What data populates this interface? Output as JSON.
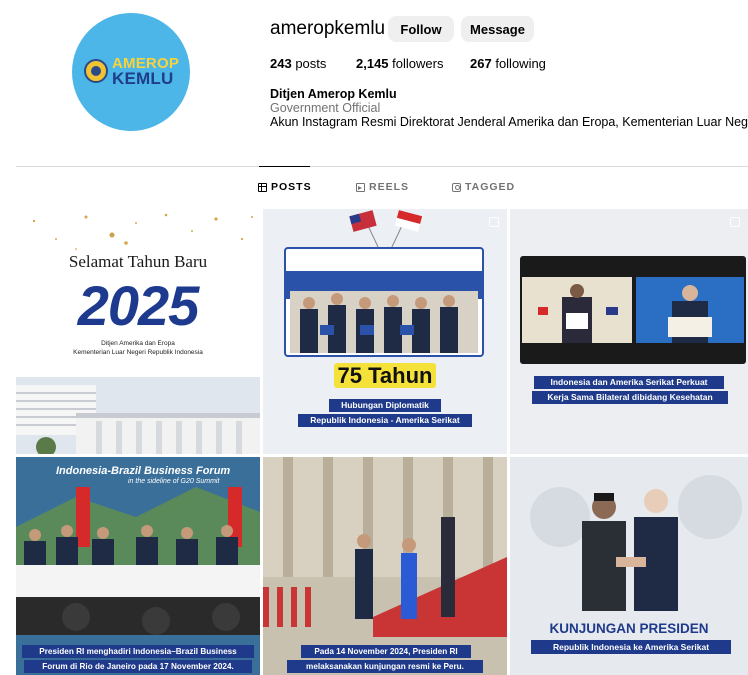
{
  "profile": {
    "username": "ameropkemlu",
    "avatar_text_line1": "AMEROP",
    "avatar_text_line2": "KEMLU",
    "follow_label": "Follow",
    "message_label": "Message",
    "posts_count": "243",
    "posts_label": "posts",
    "followers_count": "2,145",
    "followers_label": "followers",
    "following_count": "267",
    "following_label": "following",
    "display_name": "Ditjen Amerop Kemlu",
    "category": "Government Official",
    "bio": "Akun Instagram Resmi Direktorat Jenderal Amerika dan Eropa, Kementerian Luar Negeri RI"
  },
  "tabs": [
    {
      "label": "POSTS",
      "icon": "grid-icon",
      "active": true
    },
    {
      "label": "REELS",
      "icon": "reels-icon",
      "active": false
    },
    {
      "label": "TAGGED",
      "icon": "tagged-icon",
      "active": false
    }
  ],
  "posts": [
    {
      "greeting": "Selamat Tahun Baru",
      "year": "2025",
      "line1": "Ditjen Amerika dan Eropa",
      "line2": "Kementerian Luar Negeri Republik Indonesia"
    },
    {
      "headline": "75 Tahun",
      "caption1": "Hubungan Diplomatik",
      "caption2": "Republik Indonesia - Amerika Serikat"
    },
    {
      "caption1": "Indonesia dan Amerika Serikat Perkuat",
      "caption2": "Kerja Sama Bilateral dibidang Kesehatan"
    },
    {
      "banner_title": "Indonesia-Brazil Business Forum",
      "banner_sub": "in the sideline of G20 Summit",
      "caption1": "Presiden RI menghadiri Indonesia–Brazil Business",
      "caption2": "Forum di Rio de Janeiro pada 17 November 2024."
    },
    {
      "caption1": "Pada 14 November 2024, Presiden RI",
      "caption2": "melaksanakan kunjungan resmi ke Peru."
    },
    {
      "title": "KUNJUNGAN PRESIDEN",
      "caption": "Republik Indonesia ke Amerika Serikat"
    }
  ],
  "colors": {
    "avatar_bg": "#4db6e8",
    "caption_bg": "#1f3a8a",
    "highlight_yellow": "#f4e23b",
    "button_bg": "#efefef",
    "muted_text": "#737373"
  }
}
